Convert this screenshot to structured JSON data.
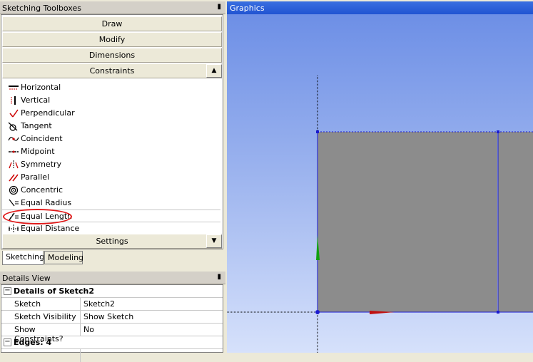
{
  "toolbox": {
    "title": "Sketching Toolboxes",
    "groups": {
      "draw": "Draw",
      "modify": "Modify",
      "dimensions": "Dimensions",
      "constraints": "Constraints",
      "settings": "Settings"
    },
    "tools": [
      "Horizontal",
      "Vertical",
      "Perpendicular",
      "Tangent",
      "Coincident",
      "Midpoint",
      "Symmetry",
      "Parallel",
      "Concentric",
      "Equal Radius",
      "Equal Length",
      "Equal Distance"
    ],
    "tabs": {
      "sketching": "Sketching",
      "modeling": "Modeling"
    }
  },
  "details": {
    "title": "Details View",
    "section": "Details of Sketch2",
    "rows": [
      {
        "key": "Sketch",
        "value": "Sketch2"
      },
      {
        "key": "Sketch Visibility",
        "value": "Show Sketch"
      },
      {
        "key": "Show Constraints?",
        "value": "No"
      }
    ],
    "edges_header": "Edges: 4"
  },
  "graphics": {
    "title": "Graphics"
  },
  "colors": {
    "selection_circle": "#e21b1b",
    "x_axis": "#c01010",
    "y_axis": "#10a010",
    "edge": "#1a1ad0"
  }
}
